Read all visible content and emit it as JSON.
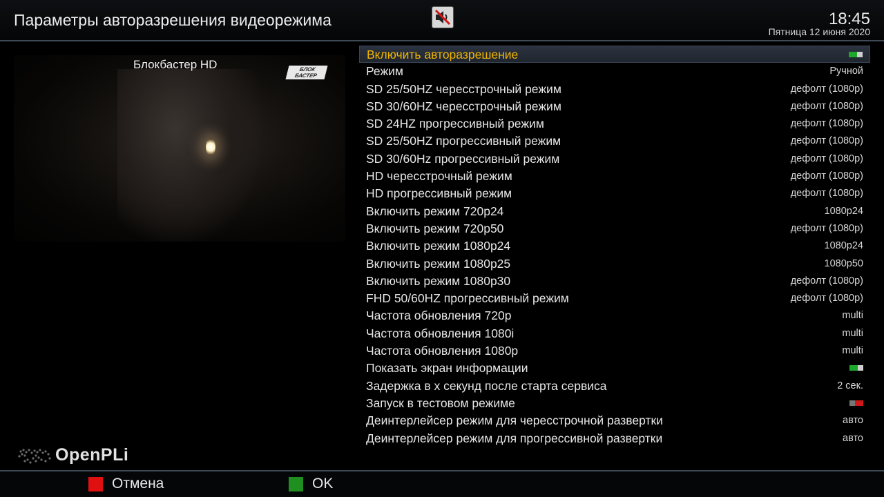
{
  "header": {
    "title": "Параметры авторазрешения видеорежима",
    "time": "18:45",
    "date": "Пятница 12 июня 2020",
    "mute_icon": "mute-speaker-icon"
  },
  "preview": {
    "channel_name": "Блокбастер HD",
    "channel_logo_line1": "БЛОК",
    "channel_logo_line2": "БАСТЕР"
  },
  "settings": [
    {
      "label": "Включить авторазрешение",
      "toggle": "on",
      "selected": true
    },
    {
      "label": "Режим",
      "value": "Ручной"
    },
    {
      "label": "SD 25/50HZ чересстрочный режим",
      "value": "дефолт (1080p)"
    },
    {
      "label": "SD 30/60HZ чересстрочный режим",
      "value": "дефолт (1080p)"
    },
    {
      "label": "SD 24HZ прогрессивный режим",
      "value": "дефолт (1080p)"
    },
    {
      "label": "SD 25/50HZ прогрессивный режим",
      "value": "дефолт (1080p)"
    },
    {
      "label": "SD 30/60Hz прогрессивный режим",
      "value": "дефолт (1080p)"
    },
    {
      "label": "HD чересстрочный режим",
      "value": "дефолт (1080p)"
    },
    {
      "label": "HD прогрессивный режим",
      "value": "дефолт (1080p)"
    },
    {
      "label": "Включить режим 720p24",
      "value": "1080p24"
    },
    {
      "label": "Включить режим 720p50",
      "value": "дефолт (1080p)"
    },
    {
      "label": "Включить режим 1080p24",
      "value": "1080p24"
    },
    {
      "label": "Включить режим 1080p25",
      "value": "1080p50"
    },
    {
      "label": "Включить режим 1080p30",
      "value": "дефолт (1080p)"
    },
    {
      "label": "FHD 50/60HZ прогрессивный режим",
      "value": "дефолт (1080p)"
    },
    {
      "label": "Частота обновления 720p",
      "value": "multi"
    },
    {
      "label": "Частота обновления 1080i",
      "value": "multi"
    },
    {
      "label": "Частота обновления 1080p",
      "value": "multi"
    },
    {
      "label": "Показать экран информации",
      "toggle": "on"
    },
    {
      "label": "Задержка в x секунд после старта сервиса",
      "value": "2 сек."
    },
    {
      "label": "Запуск в тестовом режиме",
      "toggle": "off"
    },
    {
      "label": "Деинтерлейсер режим для чересстрочной развертки",
      "value": "авто"
    },
    {
      "label": "Деинтерлейсер режим для прогрессивной развертки",
      "value": "авто"
    }
  ],
  "logo": {
    "text": "OpenPLi",
    "icon": "world-map-icon"
  },
  "footer": {
    "red_label": "Отмена",
    "green_label": "OK",
    "red_color": "#e01010",
    "green_color": "#1f8f1f"
  },
  "colors": {
    "selected_text": "#f0b400",
    "toggle_on": "#1ea82b",
    "toggle_off": "#d01818"
  }
}
